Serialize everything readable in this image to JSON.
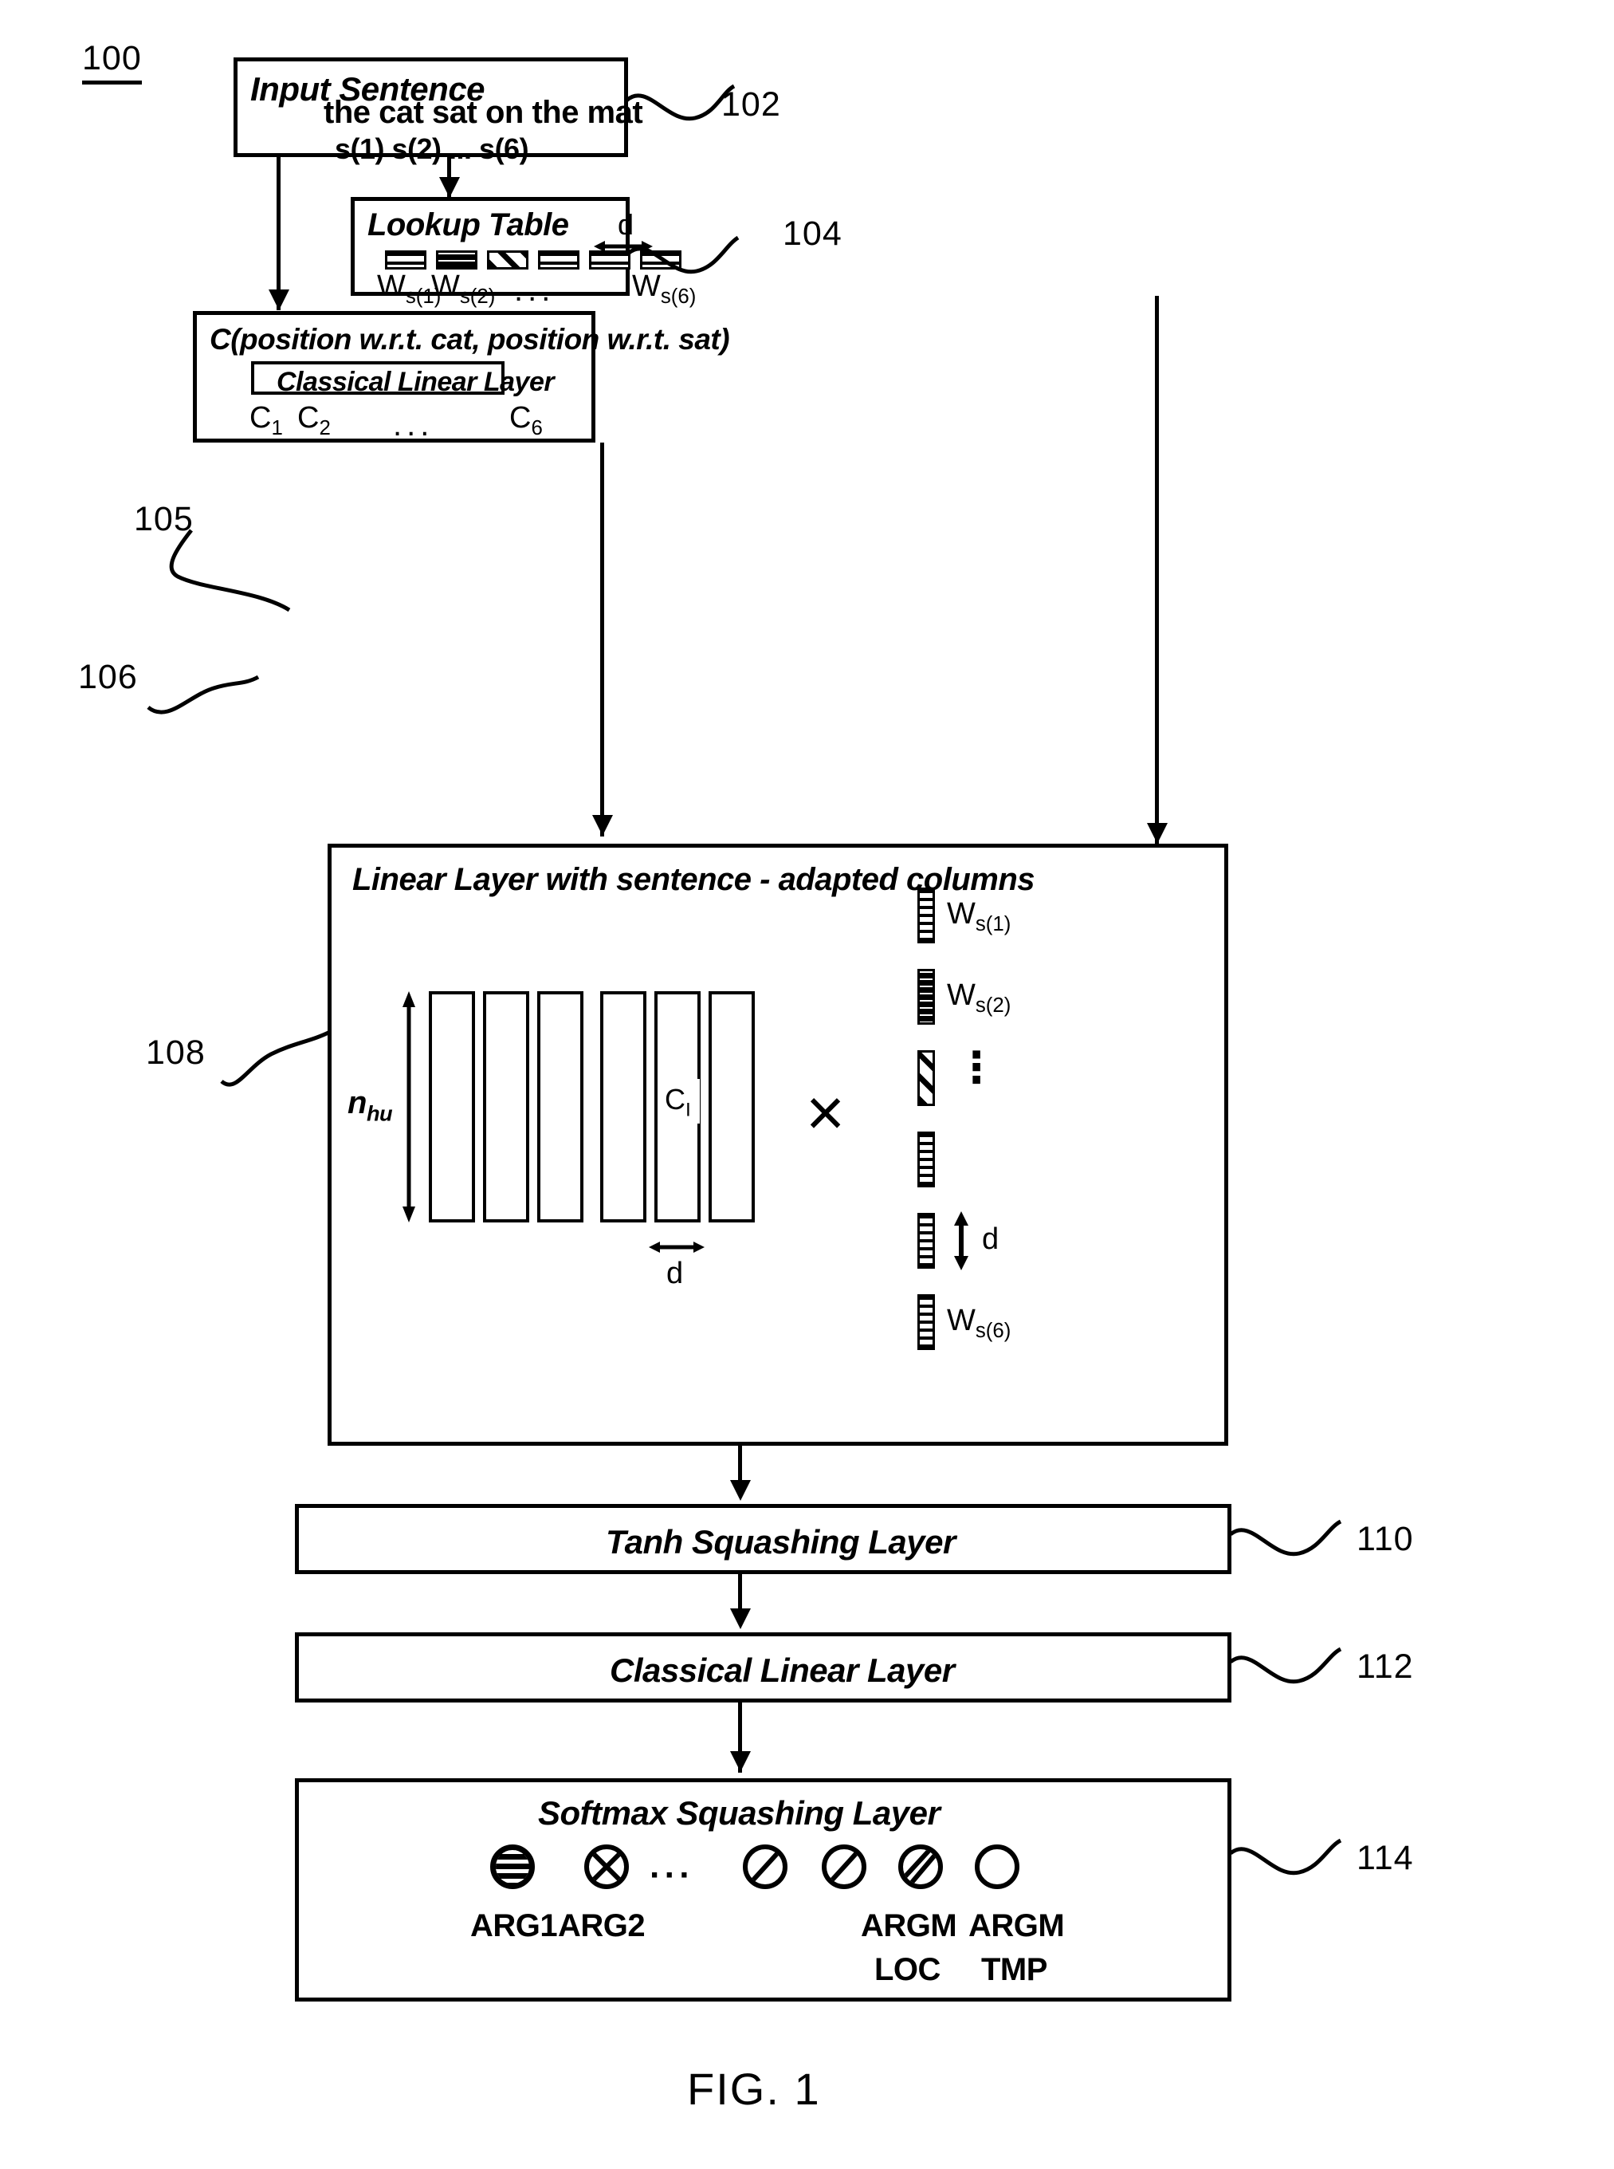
{
  "figure": {
    "system_number": "100",
    "caption": "FIG. 1"
  },
  "refs": {
    "input_sentence": "102",
    "lookup_table": "104",
    "classical_linear_layer_inner": "105",
    "context_box": "106",
    "linear_layer_adapted": "108",
    "tanh": "110",
    "classical_linear": "112",
    "softmax": "114"
  },
  "input_box": {
    "title": "Input Sentence",
    "sentence": "the cat sat on the mat",
    "tokens_line": "s(1) s(2)     ...      s(6)"
  },
  "lookup_table": {
    "title": "Lookup Table",
    "dim_label": "d",
    "labels": [
      "W",
      "s(1)",
      "W",
      "s(2)",
      "...",
      "W",
      "s(6)"
    ],
    "entries": [
      {
        "label_base": "W",
        "label_sub": "s(1)",
        "pattern": "hstripe"
      },
      {
        "label_base": "W",
        "label_sub": "s(2)",
        "pattern": "dark"
      },
      {
        "label_base": "",
        "label_sub": "",
        "pattern": "diag"
      },
      {
        "label_base": "",
        "label_sub": "",
        "pattern": "hstripe"
      },
      {
        "label_base": "",
        "label_sub": "",
        "pattern": "hstripe"
      },
      {
        "label_base": "W",
        "label_sub": "s(6)",
        "pattern": "hstripe"
      }
    ],
    "ellipsis": "..."
  },
  "context_box": {
    "title": "C(position w.r.t. cat, position w.r.t. sat)",
    "inner_label": "Classical Linear Layer",
    "outputs": [
      {
        "base": "C",
        "sub": "1"
      },
      {
        "base": "C",
        "sub": "2"
      },
      {
        "base": "C",
        "sub": "6"
      }
    ],
    "ellipsis": "..."
  },
  "linear_layer": {
    "title": "Linear Layer with sentence - adapted columns",
    "row_dim_base": "n",
    "row_dim_sub": "hu",
    "col_dim_label": "d",
    "vec_dim_label": "d",
    "multiply_symbol": "×",
    "column_patterns": [
      "hstripe",
      "grid",
      "diag",
      "hstripe",
      "hstripe",
      "hstripe"
    ],
    "highlighted_column_label_base": "C",
    "highlighted_column_label_sub": "I",
    "vectors": [
      {
        "base": "W",
        "sub": "s(1)",
        "pattern": "vfine"
      },
      {
        "base": "W",
        "sub": "s(2)",
        "pattern": "dark"
      },
      {
        "base": "",
        "sub": "",
        "pattern": "diag"
      },
      {
        "base": "",
        "sub": "",
        "pattern": "vfine"
      },
      {
        "base": "",
        "sub": "",
        "pattern": "vfine"
      },
      {
        "base": "W",
        "sub": "s(6)",
        "pattern": "vfine"
      }
    ],
    "vertical_ellipsis": "⋮"
  },
  "tanh_box": {
    "label": "Tanh Squashing Layer"
  },
  "classical_box": {
    "label": "Classical Linear Layer"
  },
  "softmax_box": {
    "title": "Softmax Squashing Layer",
    "ellipsis": "···",
    "outputs": [
      {
        "label_top": "ARG1",
        "label_bottom": "",
        "glyph": "filled-grid-circle"
      },
      {
        "label_top": "ARG2",
        "label_bottom": "",
        "glyph": "crossed-circle"
      },
      {
        "label_top": "",
        "label_bottom": "",
        "glyph": "slashed-circle"
      },
      {
        "label_top": "",
        "label_bottom": "",
        "glyph": "slashed-circle"
      },
      {
        "label_top": "ARGM",
        "label_bottom": "LOC",
        "glyph": "double-slashed-circle"
      },
      {
        "label_top": "ARGM",
        "label_bottom": "TMP",
        "glyph": "empty-circle"
      }
    ]
  },
  "colors": {
    "ink": "#000000",
    "paper": "#ffffff"
  }
}
